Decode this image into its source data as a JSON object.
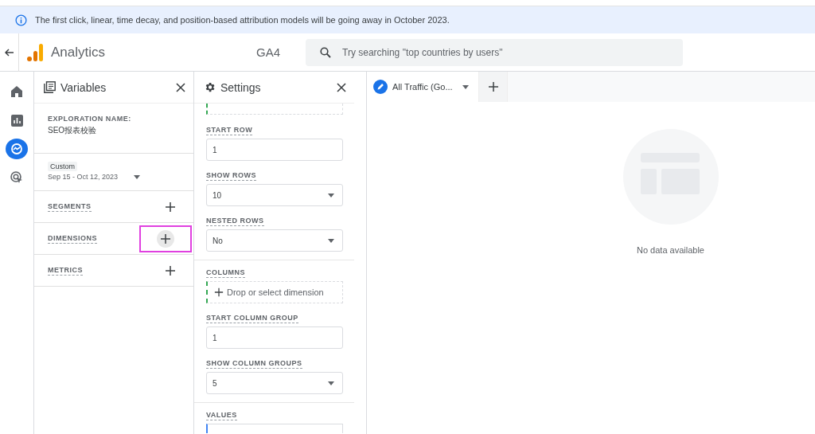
{
  "banner": {
    "text": "The first click, linear, time decay, and position-based attribution models will be going away in October 2023."
  },
  "header": {
    "product": "Analytics",
    "property_suffix": "GA4",
    "search": {
      "placeholder": "Try searching \"top countries by users\""
    }
  },
  "rail": [
    {
      "kind": "home",
      "selected": false
    },
    {
      "kind": "reports",
      "selected": false
    },
    {
      "kind": "explore",
      "selected": true
    },
    {
      "kind": "advertising",
      "selected": false
    }
  ],
  "variables": {
    "title": "Variables",
    "exploration_label": "EXPLORATION NAME:",
    "exploration_name": "SEO报表校验",
    "date_chip": "Custom",
    "date_range": "Sep 15 - Oct 12, 2023",
    "sections": [
      {
        "label": "SEGMENTS",
        "highlighted": false
      },
      {
        "label": "DIMENSIONS",
        "highlighted": true
      },
      {
        "label": "METRICS",
        "highlighted": false
      }
    ]
  },
  "settings": {
    "title": "Settings",
    "groups": [
      [
        {
          "kind": "input",
          "label": "START ROW",
          "value": "1"
        },
        {
          "kind": "select",
          "label": "SHOW ROWS",
          "value": "10"
        },
        {
          "kind": "select",
          "label": "NESTED ROWS",
          "value": "No"
        }
      ],
      [
        {
          "kind": "drop",
          "label": "COLUMNS",
          "value": "Drop or select dimension"
        },
        {
          "kind": "input",
          "label": "START COLUMN GROUP",
          "value": "1"
        },
        {
          "kind": "select",
          "label": "SHOW COLUMN GROUPS",
          "value": "5"
        }
      ],
      [
        {
          "kind": "partial",
          "label": "VALUES"
        }
      ]
    ]
  },
  "tabs": [
    {
      "label": "All Traffic (Go...",
      "selected": true
    }
  ],
  "canvas": {
    "empty_text": "No data available"
  }
}
